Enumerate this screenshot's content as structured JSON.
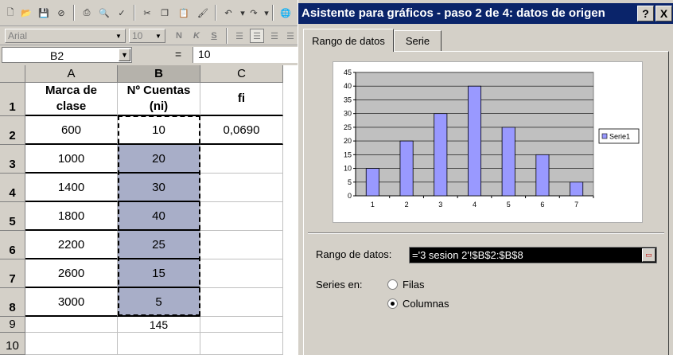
{
  "toolbar": {
    "icons": [
      "new-icon",
      "open-icon",
      "save-icon",
      "permission-icon",
      "print-icon",
      "print-preview-icon",
      "spelling-icon",
      "cut-icon",
      "copy-icon",
      "paste-icon",
      "format-painter-icon",
      "undo-icon",
      "redo-icon",
      "web-icon"
    ]
  },
  "format": {
    "font": "Arial",
    "size": "10",
    "bold": "N",
    "italic": "K",
    "underline": "S"
  },
  "formula": {
    "name_box": "B2",
    "equals": "=",
    "value": "10"
  },
  "sheet": {
    "columns": [
      "A",
      "B",
      "C"
    ],
    "row_numbers": [
      "1",
      "2",
      "3",
      "4",
      "5",
      "6",
      "7",
      "8",
      "9",
      "10"
    ],
    "header_row": {
      "a": "Marca de\nclase",
      "b": "Nº Cuentas\n(ni)",
      "c": "fi"
    },
    "rows": [
      {
        "a": "600",
        "b": "10",
        "c": "0,0690"
      },
      {
        "a": "1000",
        "b": "20",
        "c": ""
      },
      {
        "a": "1400",
        "b": "30",
        "c": ""
      },
      {
        "a": "1800",
        "b": "40",
        "c": ""
      },
      {
        "a": "2200",
        "b": "25",
        "c": ""
      },
      {
        "a": "2600",
        "b": "15",
        "c": ""
      },
      {
        "a": "3000",
        "b": "5",
        "c": ""
      }
    ],
    "total": "145"
  },
  "dialog": {
    "title": "Asistente para gráficos - paso 2 de 4: datos de origen",
    "help_button": "?",
    "close_button": "X",
    "tabs": [
      "Rango de datos",
      "Serie"
    ],
    "range_label": "Rango de datos:",
    "range_value": "='3 sesion 2'!$B$2:$B$8",
    "series_label": "Series en:",
    "option_rows": "Filas",
    "option_columns": "Columnas",
    "selected_option": "Columnas"
  },
  "chart_data": {
    "type": "bar",
    "categories": [
      "1",
      "2",
      "3",
      "4",
      "5",
      "6",
      "7"
    ],
    "series": [
      {
        "name": "Serie1",
        "values": [
          10,
          20,
          30,
          40,
          25,
          15,
          5
        ]
      }
    ],
    "ylim": [
      0,
      45
    ],
    "yticks": [
      "0",
      "5",
      "10",
      "15",
      "20",
      "25",
      "30",
      "35",
      "40",
      "45"
    ],
    "grid": true,
    "legend": "right",
    "colors": {
      "bar": "#9999ff",
      "plot_bg": "#c0c0c0"
    }
  }
}
